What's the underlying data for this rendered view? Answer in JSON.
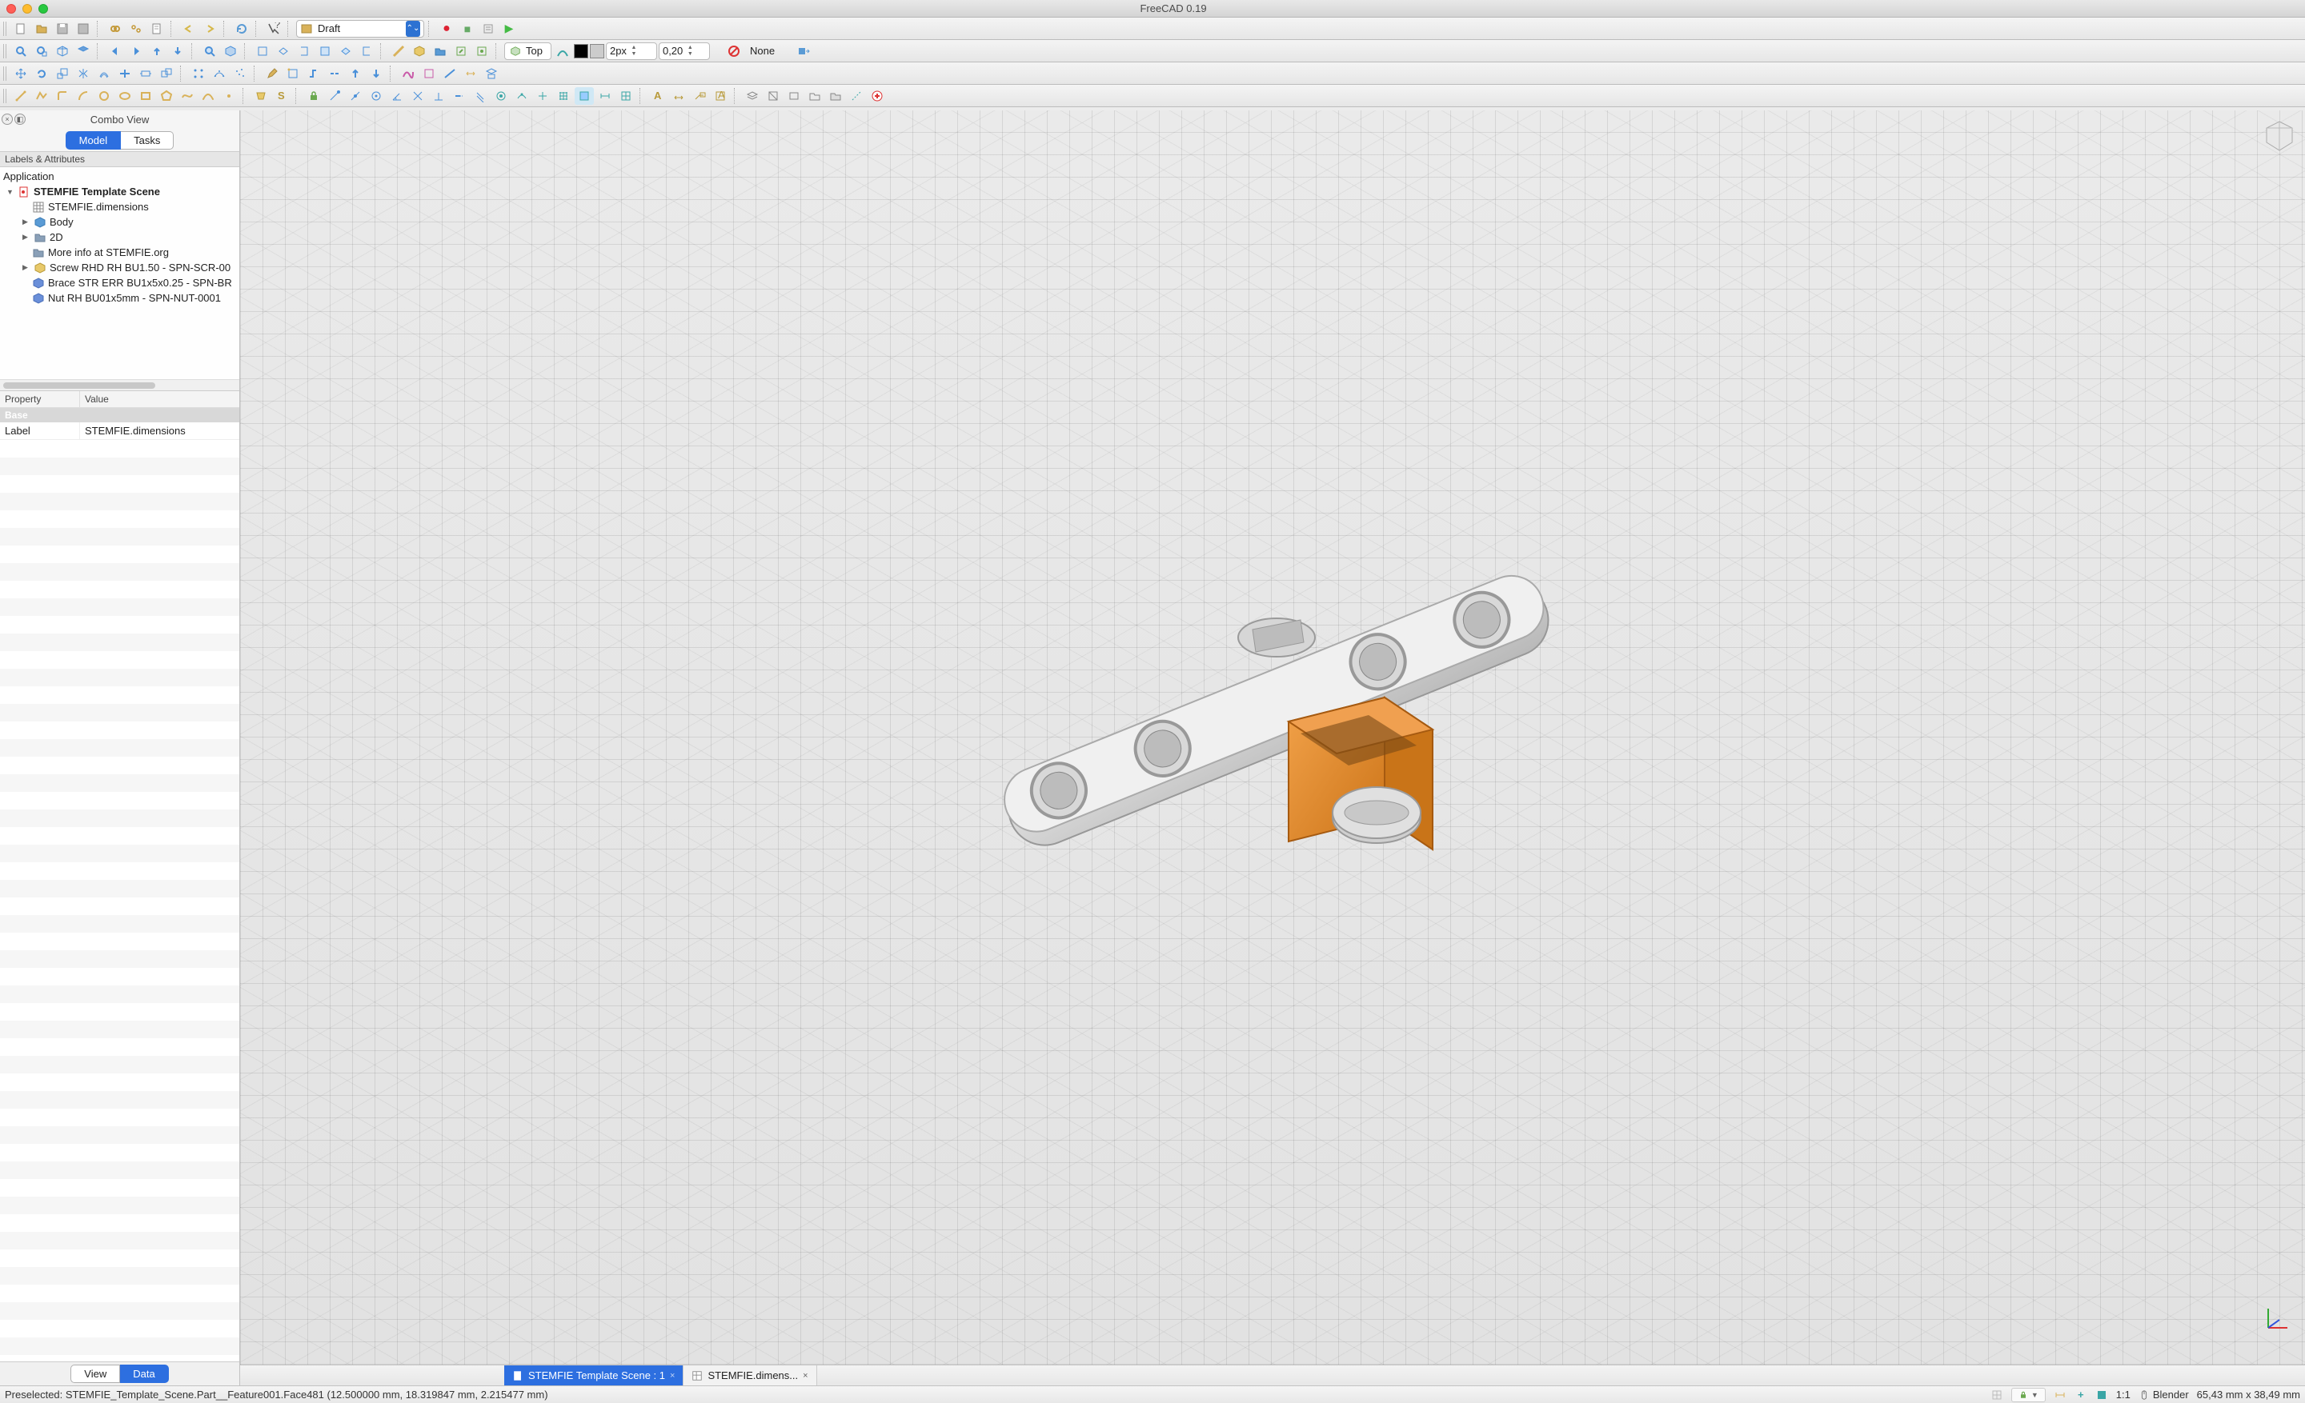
{
  "window": {
    "title": "FreeCAD 0.19"
  },
  "workbench_selector": {
    "label": "Draft",
    "icon": "draft-icon"
  },
  "macro_controls": {
    "record": "●",
    "stop": "■",
    "edit": "≡",
    "play": "▶"
  },
  "toolbar2": {
    "view_name": "Top",
    "line_width_value": "2px",
    "dim_precision_value": "0,20",
    "fill_label": "None"
  },
  "combo_view": {
    "title": "Combo View",
    "tabs": {
      "model": "Model",
      "tasks": "Tasks"
    },
    "labels_header": "Labels & Attributes",
    "tree": {
      "root": "Application",
      "doc": "STEMFIE Template Scene",
      "items": [
        {
          "label": "STEMFIE.dimensions",
          "icon": "spreadsheet-icon",
          "indent": 2
        },
        {
          "label": "Body",
          "icon": "body-icon",
          "indent": 2,
          "disclosure": "▶"
        },
        {
          "label": "2D",
          "icon": "folder-icon",
          "indent": 2,
          "disclosure": "▶"
        },
        {
          "label": "More info at STEMFIE.org",
          "icon": "folder-icon",
          "indent": 2
        },
        {
          "label": "Screw RHD RH BU1.50 - SPN-SCR-00",
          "icon": "part-link-icon",
          "indent": 2,
          "disclosure": "▶"
        },
        {
          "label": "Brace STR ERR BU1x5x0.25 - SPN-BR",
          "icon": "part-icon",
          "indent": 2
        },
        {
          "label": "Nut RH BU01x5mm - SPN-NUT-0001",
          "icon": "part-icon",
          "indent": 2
        }
      ]
    },
    "properties": {
      "col_property": "Property",
      "col_value": "Value",
      "group": "Base",
      "rows": [
        {
          "name": "Label",
          "value": "STEMFIE.dimensions"
        }
      ]
    },
    "bottom_tabs": {
      "view": "View",
      "data": "Data"
    }
  },
  "doc_tabs": {
    "tab1": "STEMFIE Template Scene : 1",
    "tab2": "STEMFIE.dimens..."
  },
  "statusbar": {
    "preselected": "Preselected: STEMFIE_Template_Scene.Part__Feature001.Face481 (12.500000 mm, 18.319847 mm, 2.215477 mm)",
    "ratio": "1:1",
    "nav_style": "Blender",
    "dimensions": "65,43 mm x 38,49 mm"
  },
  "colors": {
    "accent": "#2d6fe0",
    "part_orange": "#e88a2a",
    "part_grey": "#c9c9c9"
  }
}
